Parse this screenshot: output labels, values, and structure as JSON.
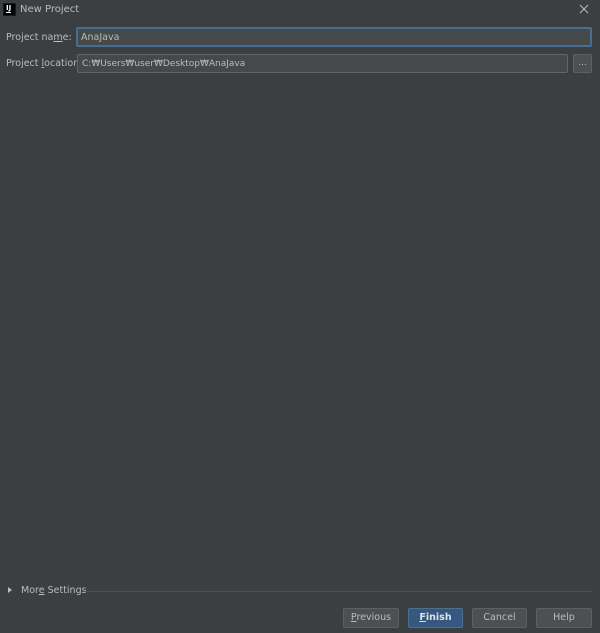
{
  "window": {
    "title": "New Project",
    "app_icon": "intellij-idea-icon",
    "app_icon_text": "IJ",
    "close_icon": "close-icon"
  },
  "form": {
    "project_name": {
      "label_before": "Project na",
      "label_mnemonic": "m",
      "label_after": "e:",
      "value": "AnaJava"
    },
    "project_location": {
      "label_before": "Project ",
      "label_mnemonic": "l",
      "label_after": "ocation:",
      "value": "C:₩Users₩user₩Desktop₩AnaJava",
      "browse_label": "..."
    }
  },
  "more_settings": {
    "label_before": "Mor",
    "label_mnemonic": "e",
    "label_after": " Settings",
    "expanded": false
  },
  "buttons": {
    "previous": {
      "before": "",
      "mnemonic": "P",
      "after": "revious"
    },
    "finish": {
      "before": "",
      "mnemonic": "F",
      "after": "inish"
    },
    "cancel": {
      "label": "Cancel"
    },
    "help": {
      "label": "Help"
    }
  },
  "colors": {
    "background": "#3c3f41",
    "text": "#bbbbbb",
    "focus_border": "#466d94",
    "default_button": "#365880"
  }
}
